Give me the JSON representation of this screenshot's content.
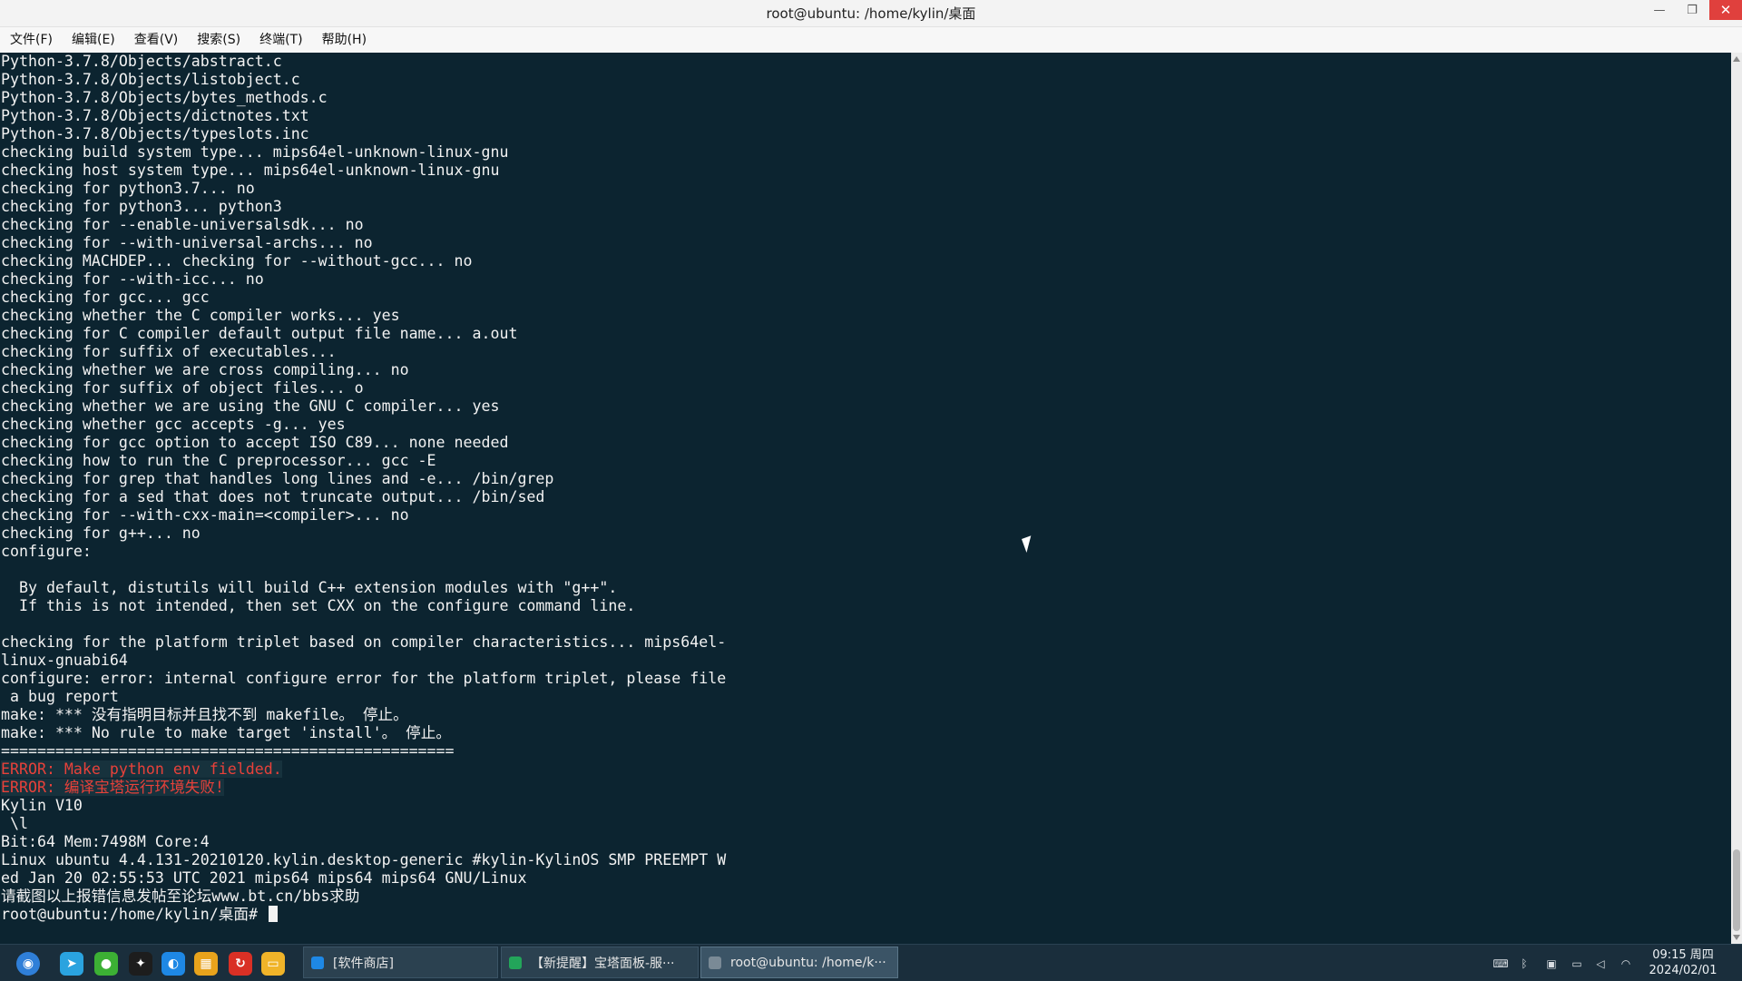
{
  "window": {
    "title": "root@ubuntu: /home/kylin/桌面",
    "min_glyph": "—",
    "max_glyph": "❐",
    "close_glyph": "✕"
  },
  "menu": [
    "文件(F)",
    "编辑(E)",
    "查看(V)",
    "搜索(S)",
    "终端(T)",
    "帮助(H)"
  ],
  "terminal": {
    "colors": {
      "background": "#0c2430",
      "text": "#f2f2f2",
      "error": "#e8413a"
    },
    "lines": [
      "Python-3.7.8/Objects/abstract.c",
      "Python-3.7.8/Objects/listobject.c",
      "Python-3.7.8/Objects/bytes_methods.c",
      "Python-3.7.8/Objects/dictnotes.txt",
      "Python-3.7.8/Objects/typeslots.inc",
      "checking build system type... mips64el-unknown-linux-gnu",
      "checking host system type... mips64el-unknown-linux-gnu",
      "checking for python3.7... no",
      "checking for python3... python3",
      "checking for --enable-universalsdk... no",
      "checking for --with-universal-archs... no",
      "checking MACHDEP... checking for --without-gcc... no",
      "checking for --with-icc... no",
      "checking for gcc... gcc",
      "checking whether the C compiler works... yes",
      "checking for C compiler default output file name... a.out",
      "checking for suffix of executables...",
      "checking whether we are cross compiling... no",
      "checking for suffix of object files... o",
      "checking whether we are using the GNU C compiler... yes",
      "checking whether gcc accepts -g... yes",
      "checking for gcc option to accept ISO C89... none needed",
      "checking how to run the C preprocessor... gcc -E",
      "checking for grep that handles long lines and -e... /bin/grep",
      "checking for a sed that does not truncate output... /bin/sed",
      "checking for --with-cxx-main=<compiler>... no",
      "checking for g++... no",
      "configure:",
      "",
      "  By default, distutils will build C++ extension modules with \"g++\".",
      "  If this is not intended, then set CXX on the configure command line.",
      "",
      "checking for the platform triplet based on compiler characteristics... mips64el-",
      "linux-gnuabi64",
      "configure: error: internal configure error for the platform triplet, please file",
      " a bug report",
      "make: *** 没有指明目标并且找不到 makefile。 停止。",
      "make: *** No rule to make target 'install'。 停止。",
      "=================================================="
    ],
    "error_lines": [
      "ERROR: Make python env fielded.",
      "ERROR: 编译宝塔运行环境失败!"
    ],
    "tail_lines": [
      "Kylin V10",
      " \\l",
      "Bit:64 Mem:7498M Core:4",
      "Linux ubuntu 4.4.131-20210120.kylin.desktop-generic #kylin-KylinOS SMP PREEMPT W",
      "ed Jan 20 02:55:53 UTC 2021 mips64 mips64 mips64 GNU/Linux",
      "请截图以上报错信息发帖至论坛www.bt.cn/bbs求助"
    ],
    "prompt": "root@ubuntu:/home/kylin/桌面# "
  },
  "taskbar": {
    "launchers": [
      {
        "name": "start-menu-icon",
        "color": "#2f7fd8",
        "glyph": "◉"
      },
      {
        "name": "telegram-icon",
        "color": "#2aa3df",
        "glyph": "➤"
      },
      {
        "name": "wechat-icon",
        "color": "#3cb034",
        "glyph": "●"
      },
      {
        "name": "qq-icon",
        "color": "#1d1d1d",
        "glyph": "✦"
      },
      {
        "name": "browser-icon",
        "color": "#1e88e5",
        "glyph": "◐"
      },
      {
        "name": "software-center-icon",
        "color": "#e8a31c",
        "glyph": "▦"
      },
      {
        "name": "pdf-reader-icon",
        "color": "#d93025",
        "glyph": "↻"
      },
      {
        "name": "file-manager-icon",
        "color": "#f0b429",
        "glyph": "▭"
      }
    ],
    "windows": [
      {
        "label": "[软件商店]",
        "icon_color": "#1e88e5",
        "active": false
      },
      {
        "label": "【新提醒】宝塔面板-服···",
        "icon_color": "#23a55a",
        "active": false
      },
      {
        "label": "root@ubuntu: /home/k···",
        "icon_color": "#7a8a96",
        "active": true
      }
    ],
    "tray": [
      {
        "name": "keyboard-icon",
        "glyph": "⌨"
      },
      {
        "name": "bluetooth-icon",
        "glyph": "ᛒ"
      },
      {
        "name": "update-icon",
        "glyph": "▣"
      },
      {
        "name": "battery-icon",
        "glyph": "▭"
      },
      {
        "name": "volume-icon",
        "glyph": "◁"
      },
      {
        "name": "wifi-icon",
        "glyph": "◠"
      }
    ],
    "clock": {
      "time": "09:15 周四",
      "date": "2024/02/01"
    }
  }
}
